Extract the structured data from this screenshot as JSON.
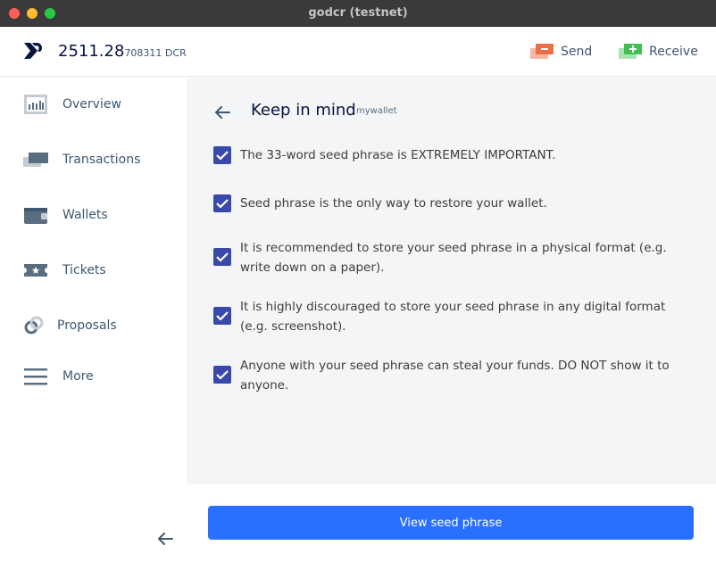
{
  "window": {
    "title": "godcr (testnet)"
  },
  "header": {
    "balance_main": "2511.28",
    "balance_small": "708311 DCR",
    "send_label": "Send",
    "receive_label": "Receive"
  },
  "sidebar": {
    "items": [
      {
        "label": "Overview",
        "icon": "overview-icon"
      },
      {
        "label": "Transactions",
        "icon": "transactions-icon"
      },
      {
        "label": "Wallets",
        "icon": "wallet-icon"
      },
      {
        "label": "Tickets",
        "icon": "ticket-icon"
      },
      {
        "label": "Proposals",
        "icon": "proposals-icon"
      },
      {
        "label": "More",
        "icon": "menu-icon"
      }
    ]
  },
  "page": {
    "title": "Keep in mind",
    "wallet_name": "mywallet",
    "items": [
      {
        "text": "The 33-word seed phrase is EXTREMELY IMPORTANT.",
        "checked": true
      },
      {
        "text": "Seed phrase is the only way to restore your wallet.",
        "checked": true
      },
      {
        "text": "It is recommended to store your seed phrase in a physical format (e.g. write down on a paper).",
        "checked": true
      },
      {
        "text": "It is highly discouraged to store your seed phrase in any digital format (e.g. screenshot).",
        "checked": true
      },
      {
        "text": "Anyone with your seed phrase can steal your funds. DO NOT show it to anyone.",
        "checked": true
      }
    ],
    "action_label": "View seed phrase"
  },
  "colors": {
    "accent": "#2970ff",
    "checkbox": "#3949ab",
    "send": "#ed6d47",
    "receive": "#41bf53"
  }
}
